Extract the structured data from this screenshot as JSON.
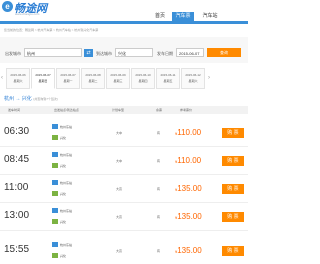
{
  "logo": {
    "mark": "e",
    "text": "畅途网",
    "sub": "www.changtu.com"
  },
  "nav": {
    "home": "首页",
    "bus": "汽车票",
    "station": "汽车站"
  },
  "breadcrumb": "您当前的位置：畅途网 > 杭州汽车票 > 杭州汽车站 > 杭州到兴化汽车票",
  "search": {
    "from_label": "出发城市",
    "from_value": "杭州",
    "to_label": "到达城市",
    "to_value": "兴化",
    "date_label": "发车日期",
    "date_value": "2015-06-07",
    "button": "查询"
  },
  "date_tabs": [
    {
      "date": "2015-06-06",
      "weekday": "星期六"
    },
    {
      "date": "2015-06-07",
      "weekday": "星期日"
    },
    {
      "date": "2015-06-07",
      "weekday": "星期一"
    },
    {
      "date": "2015-06-08",
      "weekday": "星期二"
    },
    {
      "date": "2015-06-09",
      "weekday": "星期三"
    },
    {
      "date": "2015-06-10",
      "weekday": "星期四"
    },
    {
      "date": "2015-06-11",
      "weekday": "星期五"
    },
    {
      "date": "2015-06-12",
      "weekday": "星期六"
    }
  ],
  "route": {
    "from": "杭州",
    "arrow": "→",
    "to": "兴化",
    "note": "(共查询到7个班次)"
  },
  "table_headers": [
    "发车时间",
    "出发站点/到达站点",
    "计划车型",
    "余票",
    "参考票价",
    ""
  ],
  "rows": [
    {
      "time": "06:30",
      "from_station": "杭州东站",
      "to_station": "兴化",
      "car": "大中",
      "seats": "有",
      "price": "110.00",
      "buy": "购 票"
    },
    {
      "time": "08:45",
      "from_station": "杭州东站",
      "to_station": "兴化",
      "car": "大中",
      "seats": "有",
      "price": "110.00",
      "buy": "购 票"
    },
    {
      "time": "11:00",
      "from_station": "杭州东站",
      "to_station": "兴化",
      "car": "大高",
      "seats": "有",
      "price": "135.00",
      "buy": "购 票"
    },
    {
      "time": "13:00",
      "from_station": "杭州东站",
      "to_station": "兴化",
      "car": "大高",
      "seats": "有",
      "price": "135.00",
      "buy": "购 票"
    },
    {
      "time": "15:55",
      "from_station": "杭州东站",
      "to_station": "兴化",
      "car": "大高",
      "seats": "有",
      "price": "135.00",
      "buy": "购 票"
    }
  ],
  "currency_symbol": "¥",
  "colors": {
    "brand": "#3a8fd8",
    "accent": "#ff8a00",
    "price": "#ff6600"
  }
}
